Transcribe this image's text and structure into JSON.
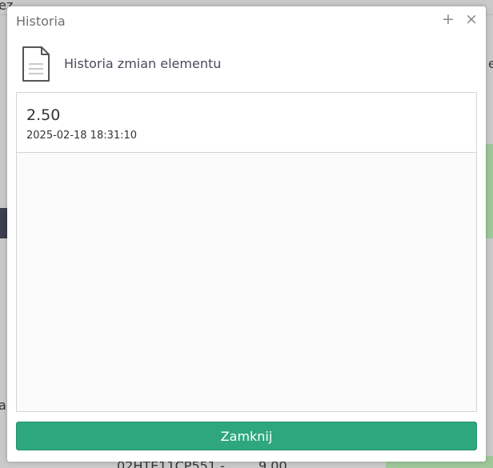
{
  "window": {
    "title": "Historia",
    "add_icon_glyph": "+",
    "close_icon_glyph": "×"
  },
  "header": {
    "icon": "document-icon",
    "text": "Historia zmian elementu"
  },
  "history": {
    "entries": [
      {
        "value": "2.50",
        "date": "2025-02-18 18:31:10"
      }
    ]
  },
  "footer": {
    "close_label": "Zamknij"
  },
  "background": {
    "top_left_fragment": "ez",
    "left_fragment": "ar",
    "bottom_code": "02HTE11CP551 -",
    "bottom_value": "9.00",
    "right_fragment": "e"
  },
  "colors": {
    "primary_button": "#2ea77f",
    "backdrop": "#c9c9c9"
  }
}
